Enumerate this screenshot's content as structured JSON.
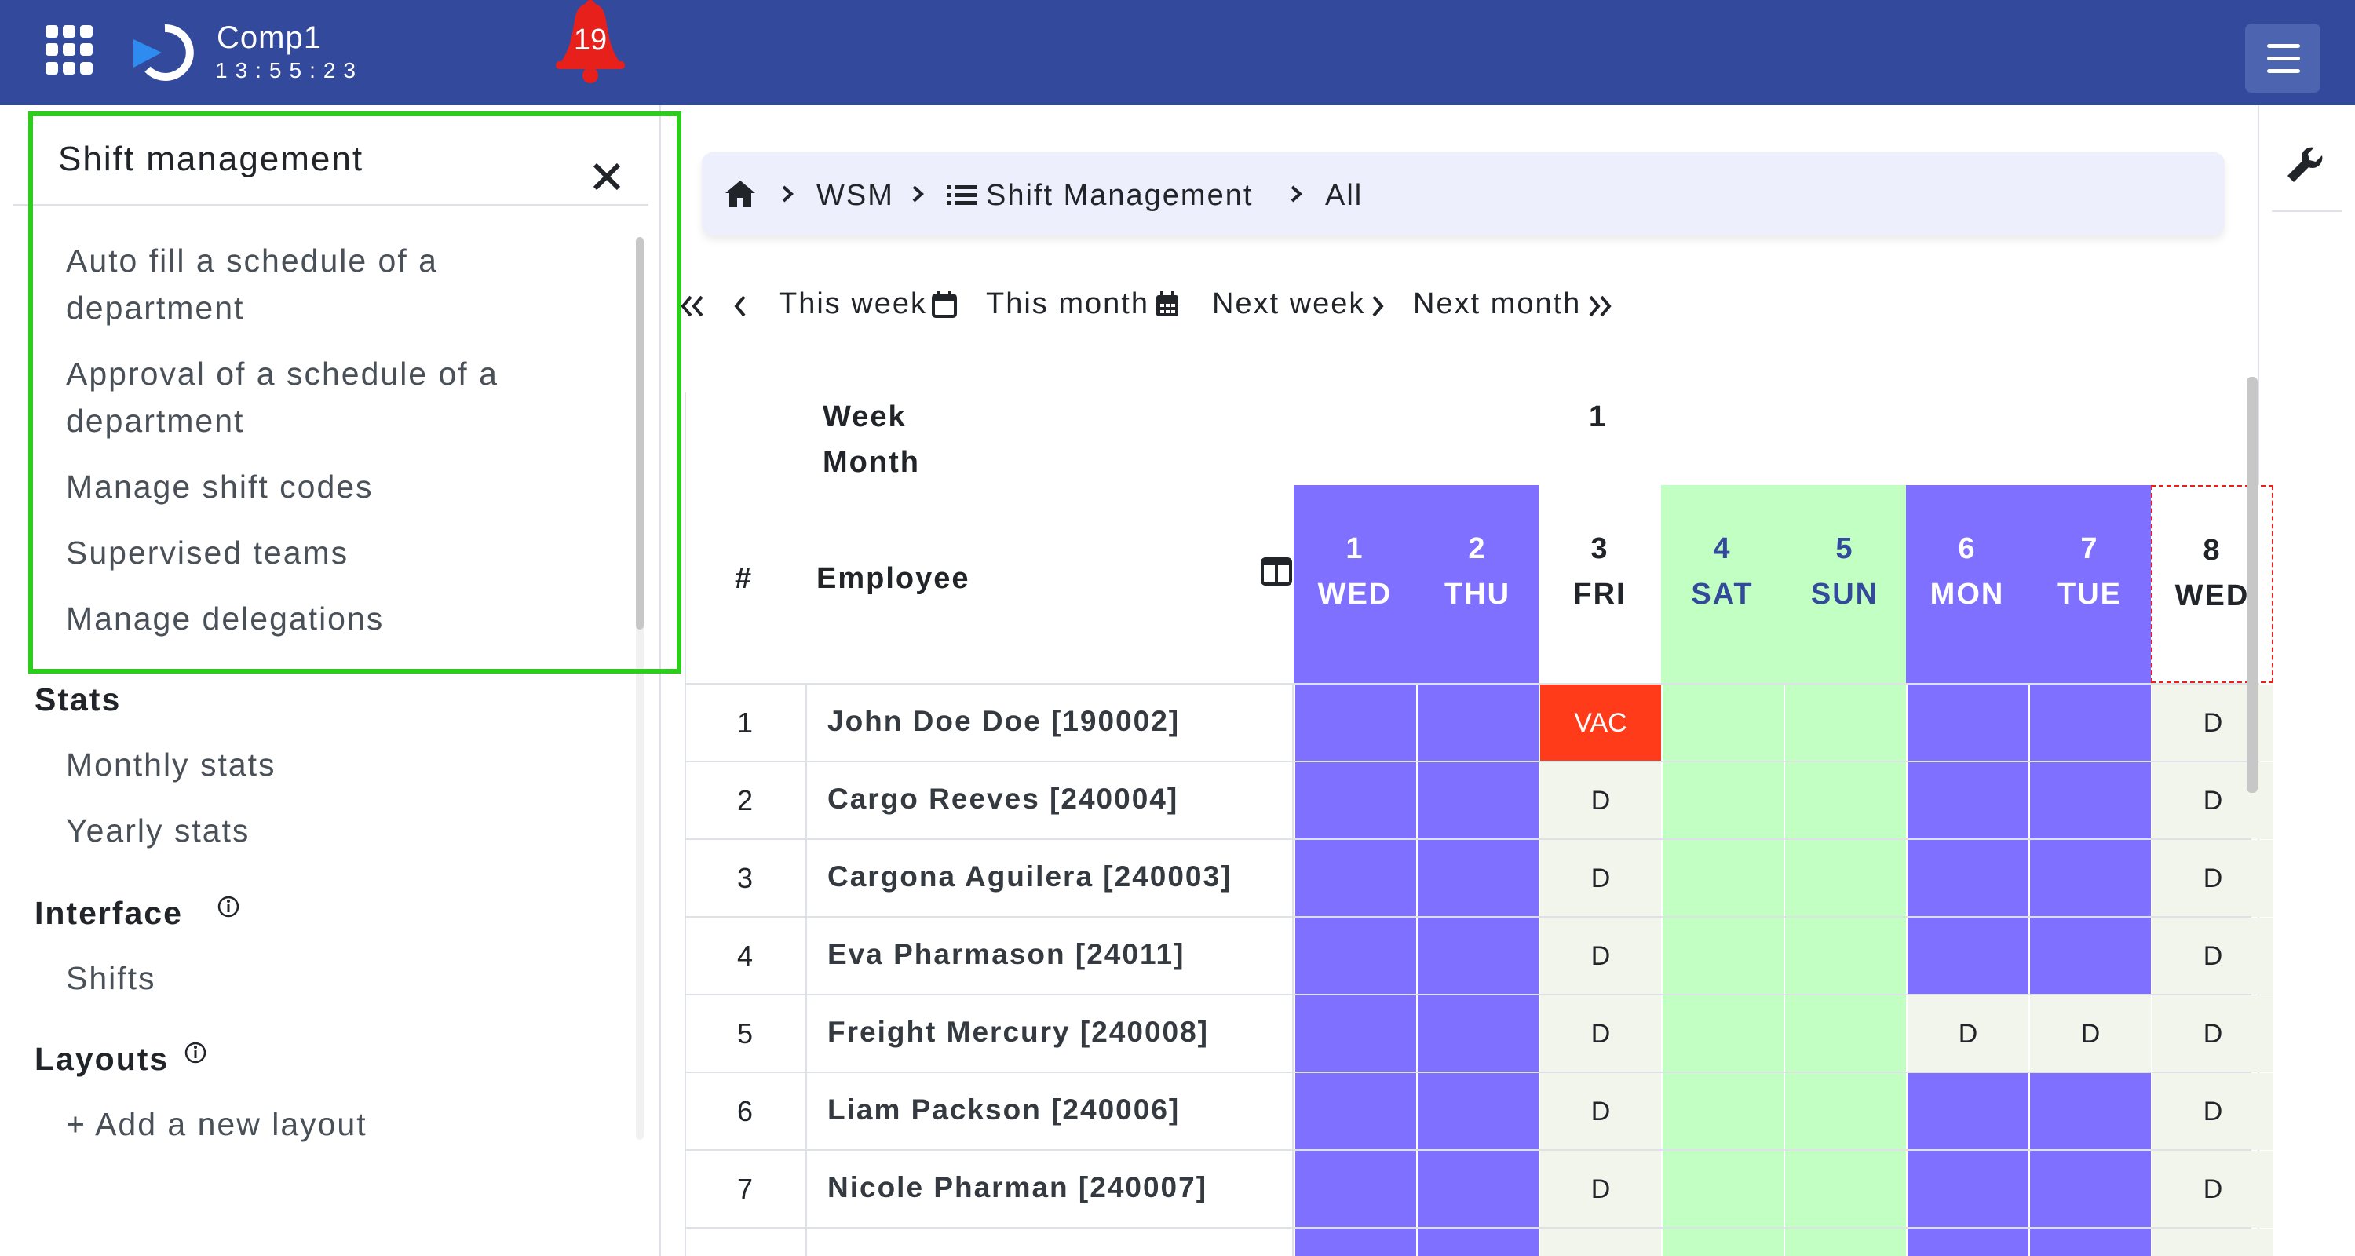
{
  "header": {
    "app_title": "Comp1",
    "clock": "13:55:23",
    "notification_count": "19"
  },
  "panel": {
    "title": "Shift management",
    "links": [
      "Auto fill a schedule of a",
      "department",
      "Approval of a schedule of a",
      "department",
      "Manage shift codes",
      "Supervised teams",
      "Manage delegations"
    ]
  },
  "sidebar": {
    "stats_heading": "Stats",
    "stats_links": [
      "Monthly stats",
      "Yearly stats"
    ],
    "interface_heading": "Interface",
    "interface_links": [
      "Shifts"
    ],
    "layouts_heading": "Layouts",
    "add_layout": "+ Add a new layout"
  },
  "breadcrumb": {
    "items": [
      "WSM",
      "Shift Management",
      "All"
    ]
  },
  "week_nav": {
    "this_week": "This week",
    "this_month": "This month",
    "next_week": "Next week",
    "next_month": "Next month"
  },
  "table": {
    "week_label": "Week",
    "month_label": "Month",
    "week_number": "1",
    "hash_label": "#",
    "employee_label": "Employee",
    "days": [
      {
        "num": "1",
        "name": "WED",
        "type": "violet"
      },
      {
        "num": "2",
        "name": "THU",
        "type": "violet"
      },
      {
        "num": "3",
        "name": "FRI",
        "type": "white"
      },
      {
        "num": "4",
        "name": "SAT",
        "type": "green"
      },
      {
        "num": "5",
        "name": "SUN",
        "type": "green"
      },
      {
        "num": "6",
        "name": "MON",
        "type": "violet"
      },
      {
        "num": "7",
        "name": "TUE",
        "type": "violet"
      },
      {
        "num": "8",
        "name": "WED",
        "type": "today"
      }
    ],
    "rows": [
      {
        "num": "1",
        "name": "John Doe Doe [190002]",
        "cells": [
          "v",
          "v",
          "VAC",
          "g",
          "g",
          "v",
          "v",
          "D"
        ]
      },
      {
        "num": "2",
        "name": "Cargo Reeves [240004]",
        "cells": [
          "v",
          "v",
          "D",
          "g",
          "g",
          "v",
          "v",
          "D"
        ]
      },
      {
        "num": "3",
        "name": "Cargona Aguilera [240003]",
        "cells": [
          "v",
          "v",
          "D",
          "g",
          "g",
          "v",
          "v",
          "D"
        ]
      },
      {
        "num": "4",
        "name": "Eva Pharmason [24011]",
        "cells": [
          "v",
          "v",
          "D",
          "g",
          "g",
          "v",
          "v",
          "D"
        ]
      },
      {
        "num": "5",
        "name": "Freight Mercury [240008]",
        "cells": [
          "v",
          "v",
          "D",
          "g",
          "g",
          "D",
          "D",
          "D"
        ]
      },
      {
        "num": "6",
        "name": "Liam Packson [240006]",
        "cells": [
          "v",
          "v",
          "D",
          "g",
          "g",
          "v",
          "v",
          "D"
        ]
      },
      {
        "num": "7",
        "name": "Nicole Pharman [240007]",
        "cells": [
          "v",
          "v",
          "D",
          "g",
          "g",
          "v",
          "v",
          "D"
        ]
      }
    ]
  },
  "colors": {
    "topbar": "#334a9c",
    "violet": "#8070ff",
    "green": "#c2ffc2",
    "vacation": "#ff3b1a",
    "plain_cell": "#f2f5ec",
    "highlight_green": "#2ecc1c",
    "day_text_blue": "#ffffff",
    "weekend_text": "#334a9c"
  },
  "icons": {
    "apps": "apps-grid-icon",
    "logo": "app-logo-icon",
    "bell": "bell-icon",
    "menu": "hamburger-icon",
    "close": "close-icon",
    "wrench": "wrench-icon",
    "home": "home-icon",
    "list": "list-icon",
    "calendar": "calendar-icon",
    "columns": "columns-icon",
    "info": "info-icon"
  }
}
